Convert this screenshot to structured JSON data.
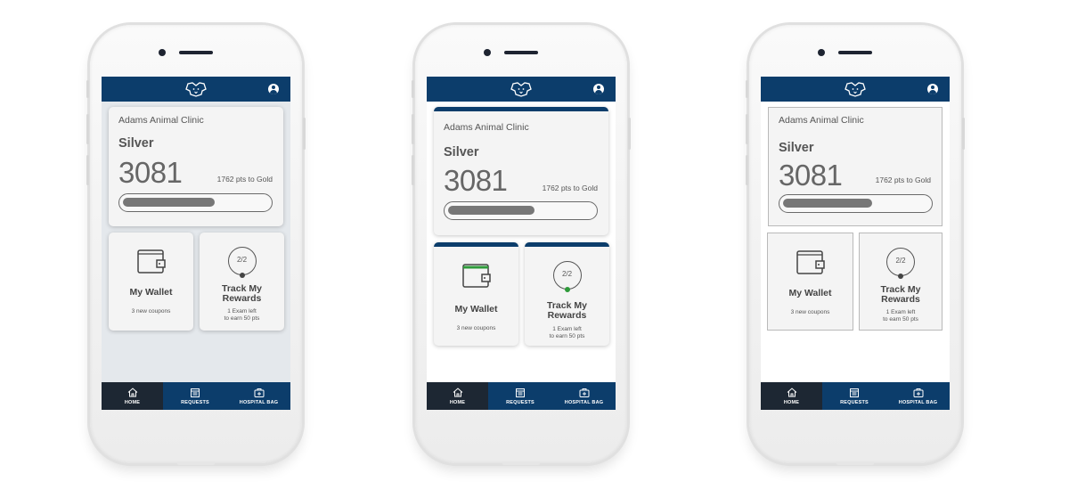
{
  "colors": {
    "brand_navy": "#0c3d6b",
    "active_tab": "#1d2733",
    "card_bg": "#f4f4f4",
    "progress_fill": "#777777",
    "wallet_accent_variant2": "#2e9a3a"
  },
  "screens": [
    {
      "variant": "shadow-cards",
      "header": {
        "logo_icon": "dog-logo-icon",
        "profile_icon": "user-circle-icon"
      },
      "card": {
        "clinic": "Adams Animal Clinic",
        "tier": "Silver",
        "points": "3081",
        "to_next": "1762 pts to Gold",
        "progress_fraction": 0.64
      },
      "wallet": {
        "icon": "wallet-icon",
        "title": "My Wallet",
        "subtitle": "3 new coupons"
      },
      "rewards": {
        "icon": "progress-ring-icon",
        "ring_text": "2/2",
        "title_line1": "Track My",
        "title_line2": "Rewards",
        "subtitle_line1": "1 Exam left",
        "subtitle_line2": "to earn 50 pts"
      },
      "nav": {
        "home": "HOME",
        "requests": "REQUESTS",
        "bag": "HOSPITAL BAG",
        "active": "home"
      }
    },
    {
      "variant": "navy-top-border-cards",
      "header": {
        "logo_icon": "dog-logo-icon",
        "profile_icon": "user-circle-icon"
      },
      "card": {
        "clinic": "Adams Animal Clinic",
        "tier": "Silver",
        "points": "3081",
        "to_next": "1762 pts to Gold",
        "progress_fraction": 0.6
      },
      "wallet": {
        "icon": "wallet-icon",
        "title": "My Wallet",
        "subtitle": "3 new coupons"
      },
      "rewards": {
        "icon": "progress-ring-icon",
        "ring_text": "2/2",
        "title_line1": "Track My",
        "title_line2": "Rewards",
        "subtitle_line1": "1 Exam left",
        "subtitle_line2": "to earn 50 pts"
      },
      "nav": {
        "home": "HOME",
        "requests": "REQUESTS",
        "bag": "HOSPITAL BAG",
        "active": "home"
      }
    },
    {
      "variant": "outlined-cards",
      "header": {
        "logo_icon": "dog-logo-icon",
        "profile_icon": "user-circle-icon"
      },
      "card": {
        "clinic": "Adams Animal Clinic",
        "tier": "Silver",
        "points": "3081",
        "to_next": "1762 pts to Gold",
        "progress_fraction": 0.62
      },
      "wallet": {
        "icon": "wallet-icon",
        "title": "My Wallet",
        "subtitle": "3 new coupons"
      },
      "rewards": {
        "icon": "progress-ring-icon",
        "ring_text": "2/2",
        "title_line1": "Track My",
        "title_line2": "Rewards",
        "subtitle_line1": "1 Exam left",
        "subtitle_line2": "to earn 50 pts"
      },
      "nav": {
        "home": "HOME",
        "requests": "REQUESTS",
        "bag": "HOSPITAL BAG",
        "active": "home"
      }
    }
  ]
}
